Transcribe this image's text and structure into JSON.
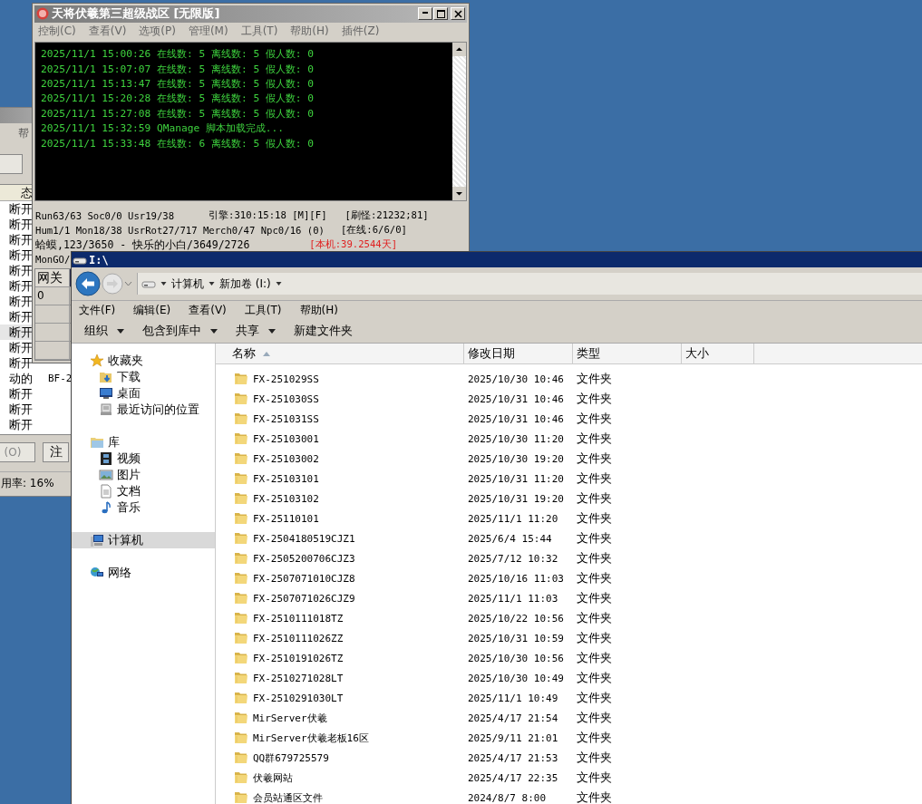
{
  "left_window": {
    "menu": [
      "帮"
    ],
    "list": {
      "column_1": "态",
      "rows": [
        {
          "column_1": "断开",
          "selected": false
        },
        {
          "column_1": "断开",
          "selected": false
        },
        {
          "column_1": "断开",
          "selected": false
        },
        {
          "column_1": "断开",
          "selected": false
        },
        {
          "column_1": "断开",
          "selected": false
        },
        {
          "column_1": "断开",
          "selected": false
        },
        {
          "column_1": "断开",
          "selected": false
        },
        {
          "column_1": "断开",
          "selected": false
        },
        {
          "column_1": "断开",
          "selected": true
        },
        {
          "column_1": "断开",
          "selected": false
        },
        {
          "column_1": "断开",
          "selected": false
        },
        {
          "column_1": "动的",
          "column_2": "BF-2",
          "selected": false
        },
        {
          "column_1": "断开",
          "selected": false
        },
        {
          "column_1": "断开",
          "selected": false
        },
        {
          "column_1": "断开",
          "selected": false
        }
      ]
    },
    "buttons": [
      "(O)",
      "注"
    ],
    "status_bar": "用率: 16%"
  },
  "top_window": {
    "title": "天将伏羲第三超级战区 [无限版]",
    "menu": [
      "控制(C)",
      "查看(V)",
      "选项(P)",
      "管理(M)",
      "工具(T)",
      "帮助(H)",
      "插件(Z)"
    ],
    "console": [
      "2025/11/1 15:00:26 在线数: 5 离线数: 5 假人数: 0",
      "2025/11/1 15:07:07 在线数: 5 离线数: 5 假人数: 0",
      "2025/11/1 15:13:47 在线数: 5 离线数: 5 假人数: 0",
      "2025/11/1 15:20:28 在线数: 5 离线数: 5 假人数: 0",
      "2025/11/1 15:27:08 在线数: 5 离线数: 5 假人数: 0",
      "2025/11/1 15:32:59 QManage 脚本加载完成...",
      "2025/11/1 15:33:48 在线数: 6 离线数: 5 假人数: 0"
    ],
    "status": [
      [
        {
          "text": "Run63/63 Soc0/0 Usr19/38",
          "kind": "normal"
        },
        {
          "text": "引擎:310:15:18 [M][F]",
          "kind": "normal"
        },
        {
          "text": "[刷怪:21232;81]",
          "kind": "normal"
        }
      ],
      [
        {
          "text": "Hum1/1 Mon18/38 UsrRot27/717 Merch0/47 Npc0/16 (0)",
          "kind": "normal"
        },
        {
          "text": "[在线:6/6/0]",
          "kind": "normal"
        }
      ],
      [
        {
          "text": "蛤蟆,123/3650 - 快乐的小白/3649/2726",
          "kind": "normal"
        },
        {
          "text": "[本机:39.2544天]",
          "kind": "alert"
        }
      ],
      [
        {
          "text": "MonGO/",
          "kind": "normal"
        }
      ]
    ],
    "table": {
      "columns": [
        "网关"
      ],
      "rows": [
        [
          "0"
        ]
      ]
    }
  },
  "explorer": {
    "title": "I:\\",
    "address": [
      "计算机",
      "新加卷 (I:)"
    ],
    "menu": [
      "文件(F)",
      "编辑(E)",
      "查看(V)",
      "工具(T)",
      "帮助(H)"
    ],
    "commands": [
      {
        "label": "组织",
        "dropdown": true
      },
      {
        "label": "包含到库中",
        "dropdown": true
      },
      {
        "label": "共享",
        "dropdown": true
      },
      {
        "label": "新建文件夹",
        "dropdown": false
      }
    ],
    "navigation": [
      {
        "label": "收藏夹",
        "selected": false,
        "children": [
          {
            "label": "下载",
            "selected": false
          },
          {
            "label": "桌面",
            "selected": false
          },
          {
            "label": "最近访问的位置",
            "selected": false
          }
        ]
      },
      {
        "label": "库",
        "selected": false,
        "children": [
          {
            "label": "视频",
            "selected": false
          },
          {
            "label": "图片",
            "selected": false
          },
          {
            "label": "文档",
            "selected": false
          },
          {
            "label": "音乐",
            "selected": false
          }
        ]
      },
      {
        "label": "计算机",
        "selected": true
      },
      {
        "label": "网络",
        "selected": false
      }
    ],
    "columns": [
      {
        "label": "名称",
        "sorted": true
      },
      {
        "label": "修改日期",
        "sorted": false
      },
      {
        "label": "类型",
        "sorted": false
      },
      {
        "label": "大小",
        "sorted": false
      }
    ],
    "rows": [
      {
        "name": "FX-251029SS",
        "modified": "2025/10/30 10:46",
        "type": "文件夹"
      },
      {
        "name": "FX-251030SS",
        "modified": "2025/10/31 10:46",
        "type": "文件夹"
      },
      {
        "name": "FX-251031SS",
        "modified": "2025/10/31 10:46",
        "type": "文件夹"
      },
      {
        "name": "FX-25103001",
        "modified": "2025/10/30 11:20",
        "type": "文件夹"
      },
      {
        "name": "FX-25103002",
        "modified": "2025/10/30 19:20",
        "type": "文件夹"
      },
      {
        "name": "FX-25103101",
        "modified": "2025/10/31 11:20",
        "type": "文件夹"
      },
      {
        "name": "FX-25103102",
        "modified": "2025/10/31 19:20",
        "type": "文件夹"
      },
      {
        "name": "FX-25110101",
        "modified": "2025/11/1 11:20",
        "type": "文件夹"
      },
      {
        "name": "FX-2504180519CJZ1",
        "modified": "2025/6/4 15:44",
        "type": "文件夹"
      },
      {
        "name": "FX-2505200706CJZ3",
        "modified": "2025/7/12 10:32",
        "type": "文件夹"
      },
      {
        "name": "FX-2507071010CJZ8",
        "modified": "2025/10/16 11:03",
        "type": "文件夹"
      },
      {
        "name": "FX-2507071026CJZ9",
        "modified": "2025/11/1 11:03",
        "type": "文件夹"
      },
      {
        "name": "FX-2510111018TZ",
        "modified": "2025/10/22 10:56",
        "type": "文件夹"
      },
      {
        "name": "FX-2510111026ZZ",
        "modified": "2025/10/31 10:59",
        "type": "文件夹"
      },
      {
        "name": "FX-2510191026TZ",
        "modified": "2025/10/30 10:56",
        "type": "文件夹"
      },
      {
        "name": "FX-2510271028LT",
        "modified": "2025/10/30 10:49",
        "type": "文件夹"
      },
      {
        "name": "FX-2510291030LT",
        "modified": "2025/11/1 10:49",
        "type": "文件夹"
      },
      {
        "name": "MirServer伏羲",
        "modified": "2025/4/17 21:54",
        "type": "文件夹"
      },
      {
        "name": "MirServer伏羲老板16区",
        "modified": "2025/9/11 21:01",
        "type": "文件夹"
      },
      {
        "name": "QQ群679725579",
        "modified": "2025/4/17 21:53",
        "type": "文件夹"
      },
      {
        "name": "伏羲网站",
        "modified": "2025/4/17 22:35",
        "type": "文件夹"
      },
      {
        "name": "会员站通区文件",
        "modified": "2024/8/7 8:00",
        "type": "文件夹"
      }
    ]
  }
}
